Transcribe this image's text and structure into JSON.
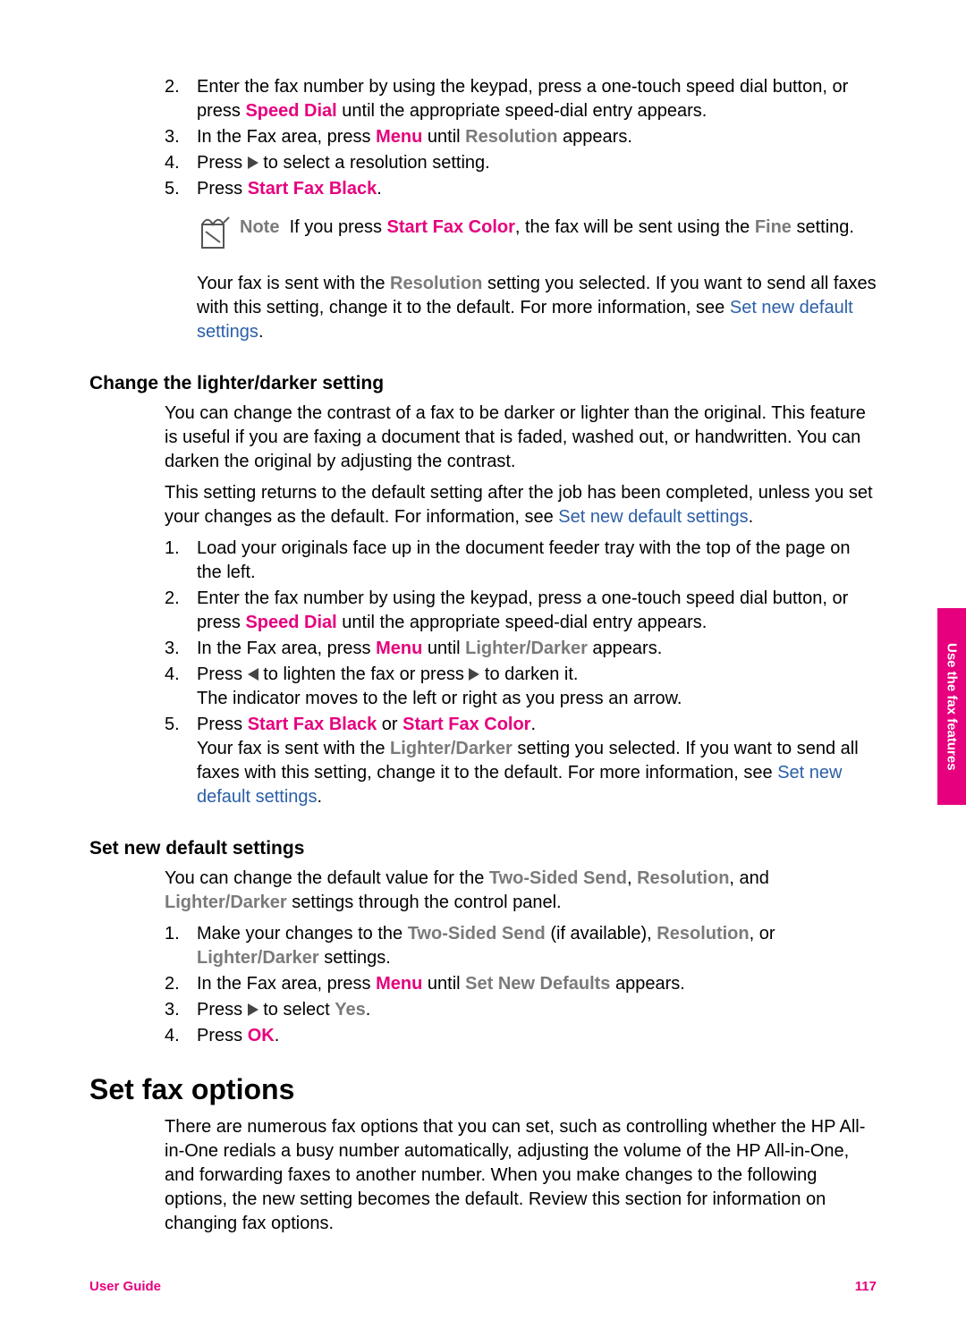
{
  "sideTab": "Use the fax features",
  "list1": {
    "i2a": "Enter the fax number by using the keypad, press a one-touch speed dial button, or press ",
    "i2b": "Speed Dial",
    "i2c": " until the appropriate speed-dial entry appears.",
    "i3a": "In the Fax area, press ",
    "i3b": "Menu",
    "i3c": " until ",
    "i3d": "Resolution",
    "i3e": " appears.",
    "i4a": "Press ",
    "i4b": " to select a resolution setting.",
    "i5a": "Press ",
    "i5b": "Start Fax Black",
    "i5c": "."
  },
  "note": {
    "label": "Note",
    "a": "If you press ",
    "b": "Start Fax Color",
    "c": ", the fax will be sent using the ",
    "d": "Fine",
    "e": " setting."
  },
  "resPara": {
    "a": "Your fax is sent with the ",
    "b": "Resolution",
    "c": " setting you selected. If you want to send all faxes with this setting, change it to the default. For more information, see ",
    "d": "Set new default settings",
    "e": "."
  },
  "h3a": "Change the lighter/darker setting",
  "ldPara1": "You can change the contrast of a fax to be darker or lighter than the original. This feature is useful if you are faxing a document that is faded, washed out, or handwritten. You can darken the original by adjusting the contrast.",
  "ldPara2": {
    "a": "This setting returns to the default setting after the job has been completed, unless you set your changes as the default. For information, see ",
    "b": "Set new default settings",
    "c": "."
  },
  "list2": {
    "i1": "Load your originals face up in the document feeder tray with the top of the page on the left.",
    "i2a": "Enter the fax number by using the keypad, press a one-touch speed dial button, or press ",
    "i2b": "Speed Dial",
    "i2c": " until the appropriate speed-dial entry appears.",
    "i3a": "In the Fax area, press ",
    "i3b": "Menu",
    "i3c": " until ",
    "i3d": "Lighter/Darker",
    "i3e": " appears.",
    "i4a": "Press ",
    "i4b": " to lighten the fax or press ",
    "i4c": " to darken it.",
    "i4d": "The indicator moves to the left or right as you press an arrow.",
    "i5a": "Press ",
    "i5b": "Start Fax Black",
    "i5c": " or ",
    "i5d": "Start Fax Color",
    "i5e": ".",
    "i5f": "Your fax is sent with the ",
    "i5g": "Lighter/Darker",
    "i5h": " setting you selected. If you want to send all faxes with this setting, change it to the default. For more information, see ",
    "i5i": "Set new default settings",
    "i5j": "."
  },
  "h3b": "Set new default settings",
  "defPara": {
    "a": "You can change the default value for the ",
    "b": "Two-Sided Send",
    "c": ", ",
    "d": "Resolution",
    "e": ", and ",
    "f": "Lighter/Darker",
    "g": " settings through the control panel."
  },
  "list3": {
    "i1a": "Make your changes to the ",
    "i1b": "Two-Sided Send",
    "i1c": " (if available), ",
    "i1d": "Resolution",
    "i1e": ", or ",
    "i1f": "Lighter/Darker",
    "i1g": " settings.",
    "i2a": "In the Fax area, press ",
    "i2b": "Menu",
    "i2c": " until ",
    "i2d": "Set New Defaults",
    "i2e": " appears.",
    "i3a": "Press ",
    "i3b": " to select ",
    "i3c": "Yes",
    "i3d": ".",
    "i4a": "Press ",
    "i4b": "OK",
    "i4c": "."
  },
  "h2": "Set fax options",
  "optPara": "There are numerous fax options that you can set, such as controlling whether the HP All-in-One redials a busy number automatically, adjusting the volume of the HP All-in-One, and forwarding faxes to another number. When you make changes to the following options, the new setting becomes the default. Review this section for information on changing fax options.",
  "footerLeft": "User Guide",
  "footerRight": "117"
}
